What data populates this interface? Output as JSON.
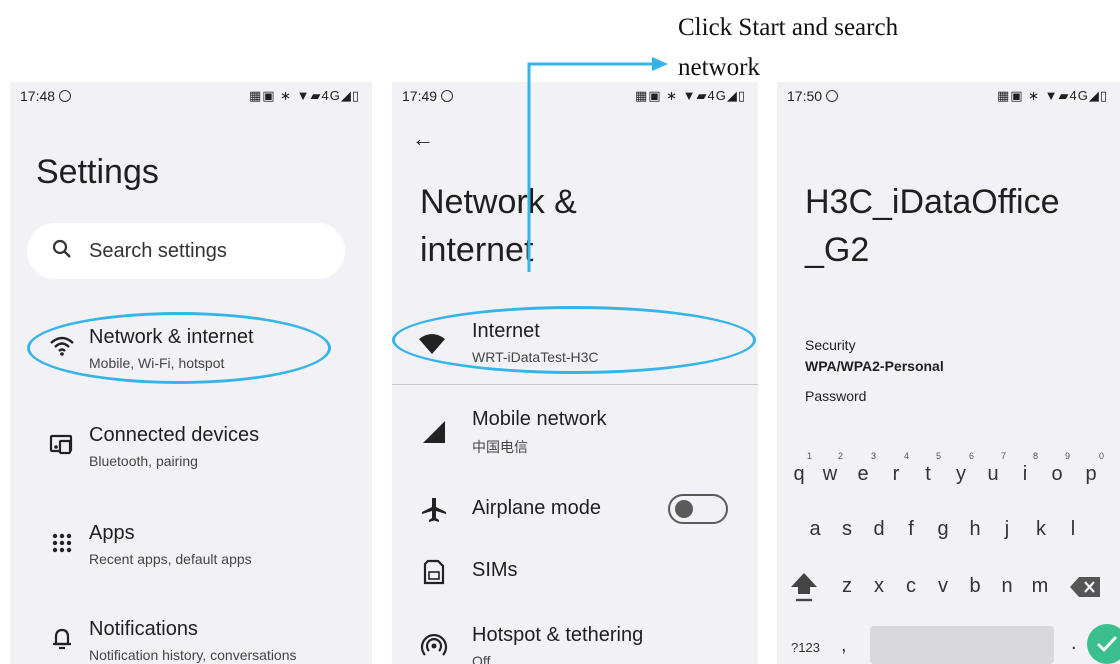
{
  "annotation": {
    "line1": "Click Start and search",
    "line2": "network",
    "arrow_color": "#35b4e9"
  },
  "screen1": {
    "time": "17:48",
    "status_icons": "▦▣ ∗ ▼▰4G◢▯",
    "title": "Settings",
    "search_placeholder": "Search settings",
    "items": [
      {
        "title": "Network & internet",
        "subtitle": "Mobile, Wi-Fi, hotspot",
        "icon": "wifi-icon"
      },
      {
        "title": "Connected devices",
        "subtitle": "Bluetooth, pairing",
        "icon": "connected-devices-icon"
      },
      {
        "title": "Apps",
        "subtitle": "Recent apps, default apps",
        "icon": "apps-grid-icon"
      },
      {
        "title": "Notifications",
        "subtitle": "Notification history, conversations",
        "icon": "bell-icon"
      }
    ]
  },
  "screen2": {
    "time": "17:49",
    "status_icons": "▦▣ ∗ ▼▰4G◢▯",
    "back_icon": "←",
    "title_line1": "Network &",
    "title_line2": "internet",
    "items": [
      {
        "title": "Internet",
        "subtitle": "WRT-iDataTest-H3C",
        "icon": "wifi-filled-icon"
      },
      {
        "title": "Mobile network",
        "subtitle": "中国电信",
        "icon": "signal-icon"
      },
      {
        "title": "Airplane mode",
        "subtitle": "",
        "icon": "airplane-icon",
        "toggle": "off"
      },
      {
        "title": "SIMs",
        "subtitle": "",
        "icon": "sim-icon"
      },
      {
        "title": "Hotspot & tethering",
        "subtitle": "Off",
        "icon": "hotspot-icon"
      }
    ]
  },
  "screen3": {
    "time": "17:50",
    "status_icons": "▦▣ ∗ ▼▰4G◢▯",
    "title_line1": "H3C_iDataOffice",
    "title_line2": "_G2",
    "security_label": "Security",
    "security_value": "WPA/WPA2-Personal",
    "password_label": "Password",
    "keyboard": {
      "row1": [
        "q",
        "w",
        "e",
        "r",
        "t",
        "y",
        "u",
        "i",
        "o",
        "p"
      ],
      "row1_hints": [
        "1",
        "2",
        "3",
        "4",
        "5",
        "6",
        "7",
        "8",
        "9",
        "0"
      ],
      "row2": [
        "a",
        "s",
        "d",
        "f",
        "g",
        "h",
        "j",
        "k",
        "l"
      ],
      "row3": [
        "z",
        "x",
        "c",
        "v",
        "b",
        "n",
        "m"
      ],
      "symbols_key": "?123",
      "comma_key": ",",
      "period_key": "."
    }
  }
}
